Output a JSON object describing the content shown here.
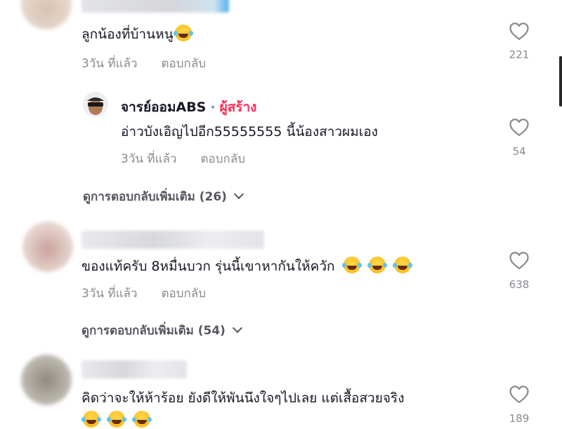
{
  "comments": [
    {
      "text": "ลูกน้องที่บ้านหนู",
      "emoji_count": 1,
      "time": "3วัน ที่แล้ว",
      "reply_label": "ตอบกลับ",
      "likes": "221"
    },
    {
      "text": "ของแท้ครับ 8หมื่นบวก รุ่นนี้เขาหากันให้ควัก",
      "emoji_count": 3,
      "time": "3วัน ที่แล้ว",
      "reply_label": "ตอบกลับ",
      "likes": "638",
      "more_replies": "ดูการตอบกลับเพิ่มเติม (54)"
    },
    {
      "text": "คิดว่าจะให้ห้าร้อย ยังดีให้พันนึงใจๆไปเลย แต่เสื้อสวยจริง",
      "emoji_count": 3,
      "likes": "189"
    }
  ],
  "reply": {
    "author": "จารย์ออมABS",
    "separator": "·",
    "creator_badge": "ผู้สร้าง",
    "text": "อ่าวบังเอิญไปอีก55555555 นี้น้องสาวผมเอง",
    "time": "3วัน ที่แล้ว",
    "reply_label": "ตอบกลับ",
    "likes": "54",
    "more_replies": "ดูการตอบกลับเพิ่มเติม (26)"
  },
  "colors": {
    "creator": "#fe2c55",
    "meta": "#8a8b91"
  },
  "icons": [
    "heart-icon",
    "chevron-down-icon",
    "laughing-emoji-icon"
  ]
}
